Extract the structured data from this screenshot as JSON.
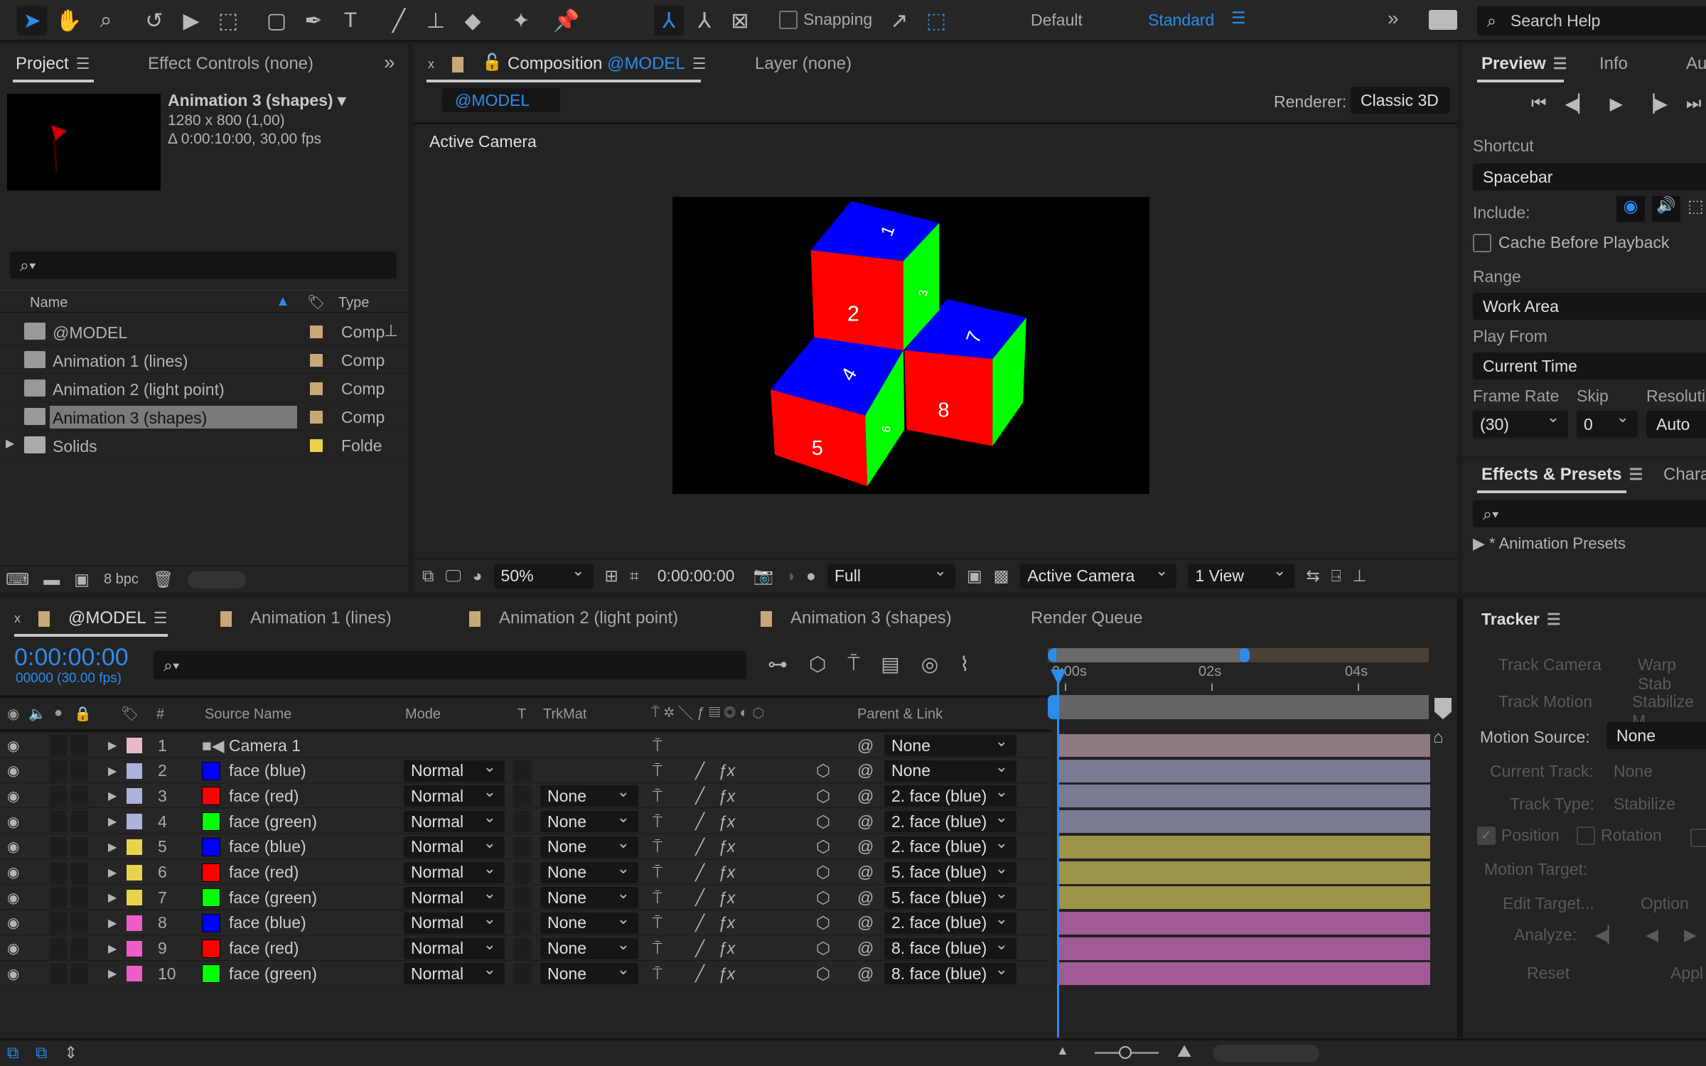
{
  "toolbar": {
    "snapping_label": "Snapping",
    "workspaces": [
      "Default",
      "Standard"
    ],
    "active_workspace": "Standard",
    "search_placeholder": "Search Help",
    "accent": "#2d8ceb"
  },
  "project": {
    "tabs": [
      "Project",
      "Effect Controls (none)"
    ],
    "item_name": "Animation 3 (shapes)",
    "item_size": "1280 x 800 (1,00)",
    "item_duration": "Δ 0:00:10:00, 30,00 fps",
    "columns": {
      "name": "Name",
      "type": "Type"
    },
    "items": [
      {
        "name": "@MODEL",
        "type": "Comp",
        "label": "#c8a878",
        "icon": "composition-icon"
      },
      {
        "name": "Animation 1 (lines)",
        "type": "Comp",
        "label": "#c8a878",
        "icon": "composition-icon"
      },
      {
        "name": "Animation 2 (light point)",
        "type": "Comp",
        "label": "#c8a878",
        "icon": "composition-icon"
      },
      {
        "name": "Animation 3 (shapes)",
        "type": "Comp",
        "label": "#c8a878",
        "icon": "composition-icon",
        "selected": true
      },
      {
        "name": "Solids",
        "type": "Folde",
        "label": "#e8d44a",
        "icon": "folder-icon"
      }
    ],
    "bpc": "8 bpc"
  },
  "composition": {
    "tab_prefix": "Composition",
    "tab_name": "@MODEL",
    "layer_tab": "Layer (none)",
    "breadcrumb": "@MODEL",
    "renderer_label": "Renderer:",
    "renderer": "Classic 3D",
    "view_label": "Active Camera",
    "footer": {
      "zoom": "50%",
      "timecode": "0:00:00:00",
      "resolution": "Full",
      "camera": "Active Camera",
      "views": "1 View"
    },
    "cube_numbers": [
      "1",
      "2",
      "3",
      "4",
      "5",
      "6",
      "7",
      "8"
    ],
    "face_colors": {
      "top": "#0000ff",
      "front": "#ff0000",
      "side": "#00ff00"
    }
  },
  "preview": {
    "tabs": [
      "Preview",
      "Info",
      "Au"
    ],
    "shortcut_label": "Shortcut",
    "shortcut": "Spacebar",
    "include_label": "Include:",
    "cache_label": "Cache Before Playback",
    "cache_checked": false,
    "range_label": "Range",
    "range": "Work Area",
    "play_from_label": "Play From",
    "play_from": "Current Time",
    "frame_rate_label": "Frame Rate",
    "frame_rate": "(30)",
    "skip_label": "Skip",
    "skip": "0",
    "resolution_label": "Resoluti",
    "resolution": "Auto"
  },
  "effects": {
    "tabs": [
      "Effects & Presets",
      "Chara"
    ],
    "tree_item": "* Animation Presets"
  },
  "timeline": {
    "tabs": [
      {
        "name": "@MODEL",
        "active": true
      },
      {
        "name": "Animation 1 (lines)"
      },
      {
        "name": "Animation 2 (light point)"
      },
      {
        "name": "Animation 3 (shapes)"
      }
    ],
    "render_queue": "Render Queue",
    "timecode": "0:00:00:00",
    "frames": "00000 (30.00 fps)",
    "columns": {
      "hash": "#",
      "source_name": "Source Name",
      "mode": "Mode",
      "t": "T",
      "trkmat": "TrkMat",
      "parent": "Parent & Link"
    },
    "ruler": [
      "0:00s",
      "02s",
      "04s"
    ],
    "playhead_seconds": 0,
    "layers": [
      {
        "num": "1",
        "name": "Camera 1",
        "label": "#e8b8c8",
        "swatch": null,
        "mode": "",
        "trkmat": "",
        "parent": "None",
        "bar": "#8d7a82"
      },
      {
        "num": "2",
        "name": "face (blue)",
        "label": "#b0b0dc",
        "swatch": "#0000ff",
        "mode": "Normal",
        "trkmat": "",
        "parent": "None",
        "bar": "#7a7a92"
      },
      {
        "num": "3",
        "name": "face (red)",
        "label": "#b0b0dc",
        "swatch": "#ff0000",
        "mode": "Normal",
        "trkmat": "None",
        "parent": "2. face (blue)",
        "bar": "#7a7a92"
      },
      {
        "num": "4",
        "name": "face (green)",
        "label": "#b0b0dc",
        "swatch": "#00ff00",
        "mode": "Normal",
        "trkmat": "None",
        "parent": "2. face (blue)",
        "bar": "#7a7a92"
      },
      {
        "num": "5",
        "name": "face (blue)",
        "label": "#e8d44a",
        "swatch": "#0000ff",
        "mode": "Normal",
        "trkmat": "None",
        "parent": "2. face (blue)",
        "bar": "#9c9448"
      },
      {
        "num": "6",
        "name": "face (red)",
        "label": "#e8d44a",
        "swatch": "#ff0000",
        "mode": "Normal",
        "trkmat": "None",
        "parent": "5. face (blue)",
        "bar": "#9c9448"
      },
      {
        "num": "7",
        "name": "face (green)",
        "label": "#e8d44a",
        "swatch": "#00ff00",
        "mode": "Normal",
        "trkmat": "None",
        "parent": "5. face (blue)",
        "bar": "#9c9448"
      },
      {
        "num": "8",
        "name": "face (blue)",
        "label": "#ef5dc8",
        "swatch": "#0000ff",
        "mode": "Normal",
        "trkmat": "None",
        "parent": "2. face (blue)",
        "bar": "#a05a96"
      },
      {
        "num": "9",
        "name": "face (red)",
        "label": "#ef5dc8",
        "swatch": "#ff0000",
        "mode": "Normal",
        "trkmat": "None",
        "parent": "8. face (blue)",
        "bar": "#a05a96"
      },
      {
        "num": "10",
        "name": "face (green)",
        "label": "#ef5dc8",
        "swatch": "#00ff00",
        "mode": "Normal",
        "trkmat": "None",
        "parent": "8. face (blue)",
        "bar": "#a05a96"
      }
    ]
  },
  "tracker": {
    "title": "Tracker",
    "track_camera": "Track Camera",
    "warp": "Warp Stab",
    "track_motion": "Track Motion",
    "stabilize": "Stabilize M",
    "motion_source_label": "Motion Source:",
    "motion_source": "None",
    "current_track_label": "Current Track:",
    "current_track": "None",
    "track_type_label": "Track Type:",
    "track_type": "Stabilize",
    "position": "Position",
    "rotation": "Rotation",
    "motion_target_label": "Motion Target:",
    "edit_target": "Edit Target...",
    "options": "Option",
    "analyze_label": "Analyze:",
    "reset": "Reset",
    "apply": "Appl"
  }
}
